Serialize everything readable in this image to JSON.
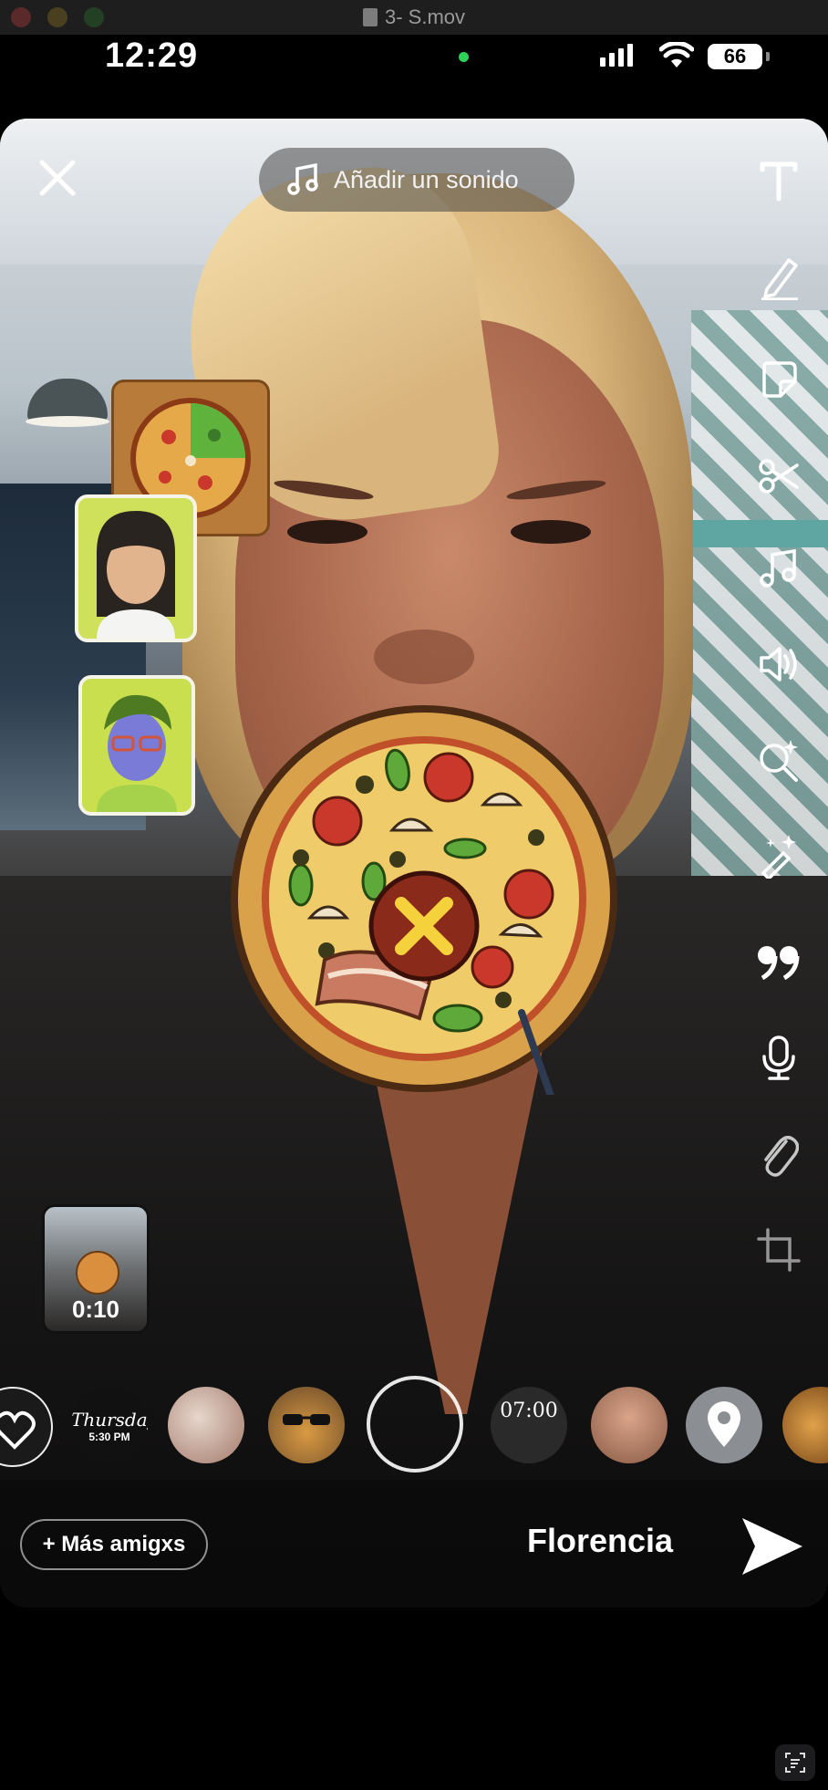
{
  "window": {
    "title": "3- S.mov"
  },
  "status_bar": {
    "time": "12:29",
    "battery": "66"
  },
  "top": {
    "sound_label": "Añadir un sonido"
  },
  "toolbar": {
    "items": [
      "text-icon",
      "pencil-icon",
      "sticker-icon",
      "scissors-icon",
      "music-icon",
      "volume-icon",
      "lens-search-icon",
      "magic-wand-icon",
      "quote-icon",
      "microphone-icon",
      "paperclip-icon",
      "crop-icon"
    ]
  },
  "thumbnail": {
    "duration": "0:10"
  },
  "carousel": {
    "items": [
      "heart",
      "thursday",
      "food",
      "guinea-pig",
      "capture",
      "clock",
      "face",
      "location",
      "burger"
    ],
    "thursday_text": "Thursday",
    "thursday_time": "5:30 PM",
    "clock_text": "07:00"
  },
  "bottom": {
    "more_friends_label": "+ Más amigxs",
    "recipient": "Florencia"
  },
  "colors": {
    "accent": "#ffffff",
    "pizza_crust": "#d9a24a",
    "x_mark": "#f5d23c"
  }
}
